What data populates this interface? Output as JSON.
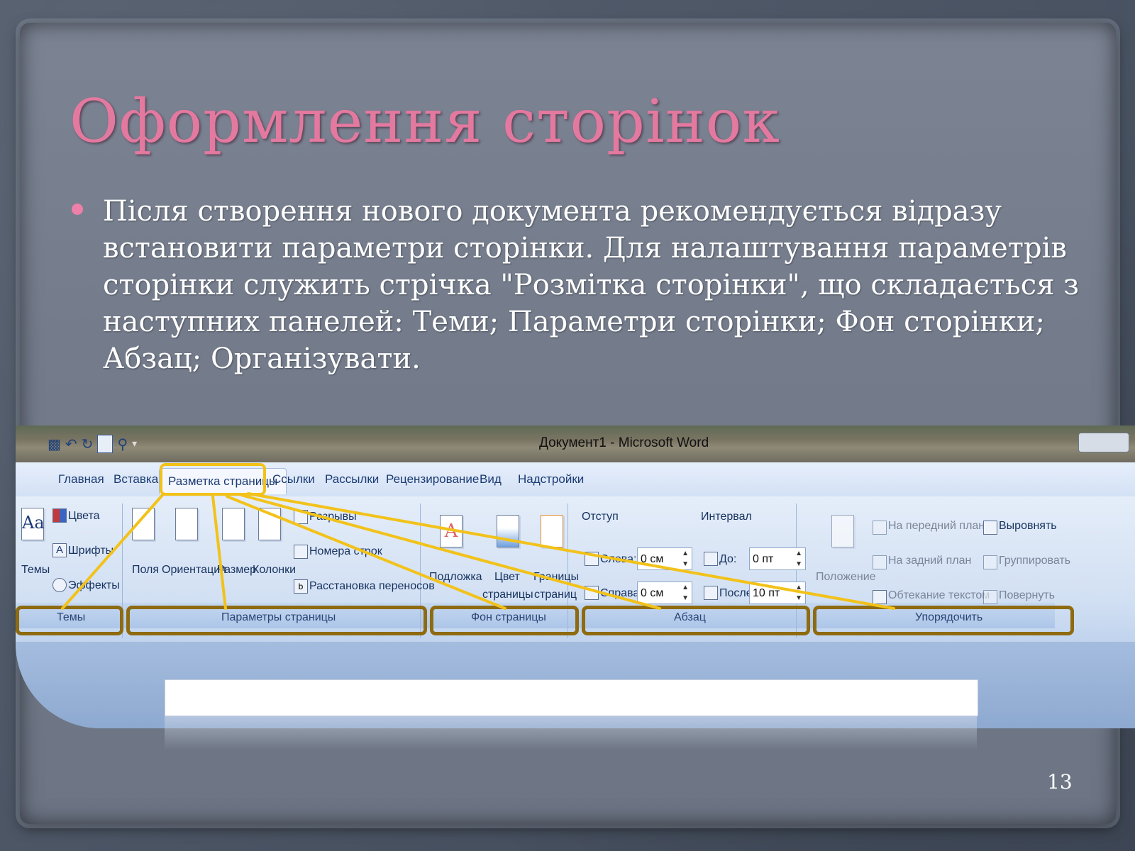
{
  "slide": {
    "title": "Оформлення сторінок",
    "body": "Після створення нового документа рекомендується відразу встановити параметри сторінки. Для налаштування параметрів сторінки служить стрічка \"Розмітка сторінки\", що складається з наступних панелей: Теми; Параметри сторінки; Фон сторінки; Абзац; Організувати.",
    "number": "13",
    "accent_color": "#e4799f",
    "highlight_color": "#f2c21a",
    "frame_color": "#8e6b10"
  },
  "word": {
    "window_title": "Документ1 - Microsoft Word",
    "tabs": [
      "Главная",
      "Вставка",
      "Разметка страницы",
      "Ссылки",
      "Рассылки",
      "Рецензирование",
      "Вид",
      "Надстройки"
    ],
    "active_tab": "Разметка страницы",
    "groups": {
      "themes": {
        "label": "Темы",
        "themes_button": "Темы",
        "colors": "Цвета",
        "fonts": "Шрифты",
        "effects": "Эффекты",
        "sample": "Aa"
      },
      "page_setup": {
        "label": "Параметры страницы",
        "margins": "Поля",
        "orientation": "Ориентация",
        "size": "Размер",
        "columns": "Колонки",
        "breaks": "Разрывы",
        "line_numbers": "Номера строк",
        "hyphenation": "Расстановка переносов"
      },
      "page_background": {
        "label": "Фон страницы",
        "watermark": "Подложка",
        "page_color_1": "Цвет",
        "page_color_2": "страницы",
        "page_borders_1": "Границы",
        "page_borders_2": "страниц"
      },
      "paragraph": {
        "label": "Абзац",
        "indent_header": "Отступ",
        "spacing_header": "Интервал",
        "left_label": "Слева:",
        "left_value": "0 см",
        "right_label": "Справа:",
        "right_value": "0 см",
        "before_label": "До:",
        "before_value": "0 пт",
        "after_label": "После:",
        "after_value": "10 пт"
      },
      "arrange": {
        "label": "Упорядочить",
        "position": "Положение",
        "bring_front": "На передний план",
        "send_back": "На задний план",
        "text_wrap": "Обтекание текстом",
        "align": "Выровнять",
        "group": "Группировать",
        "rotate": "Повернуть"
      }
    }
  }
}
